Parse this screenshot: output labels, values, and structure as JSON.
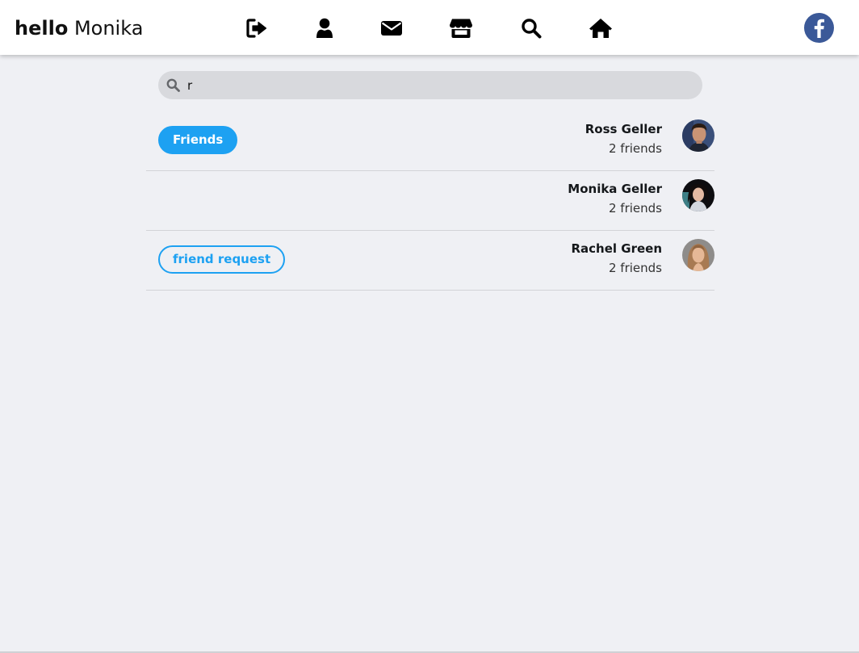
{
  "header": {
    "greeting_prefix": "hello",
    "greeting_name": "Monika",
    "nav_icons": [
      "sign-out-icon",
      "user-icon",
      "envelope-icon",
      "store-icon",
      "search-icon",
      "home-icon"
    ],
    "logo_icon": "facebook-logo-icon",
    "logo_color": "#3b5998"
  },
  "search": {
    "value": "r"
  },
  "accent_color": "#1da1f2",
  "results": [
    {
      "name": "Ross Geller",
      "friends_text": "2 friends",
      "button_label": "Friends",
      "button_style": "filled"
    },
    {
      "name": "Monika Geller",
      "friends_text": "2 friends",
      "button_label": "",
      "button_style": "none"
    },
    {
      "name": "Rachel Green",
      "friends_text": "2 friends",
      "button_label": "friend request",
      "button_style": "outline"
    }
  ]
}
